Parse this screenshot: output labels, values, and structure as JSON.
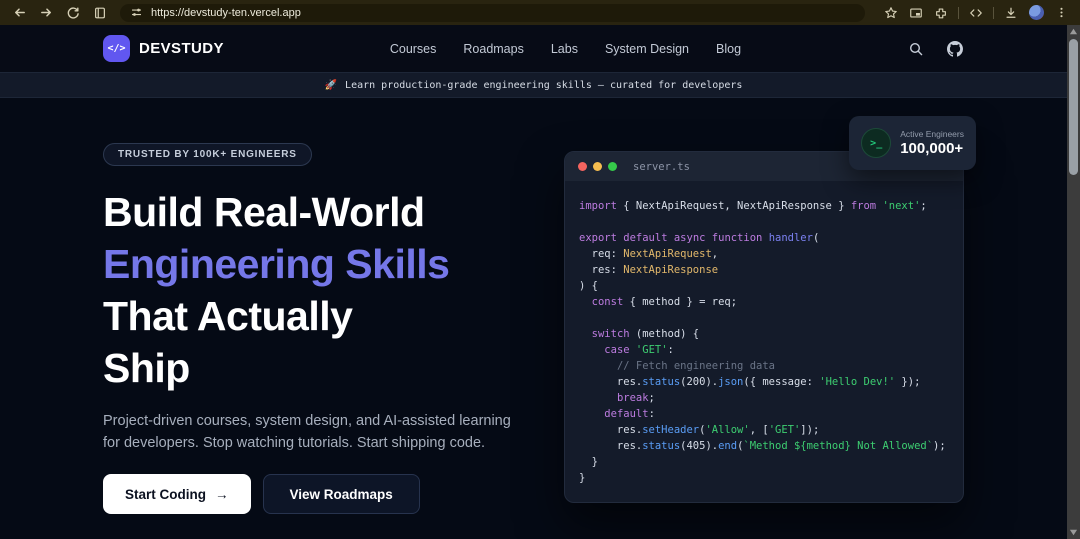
{
  "browser": {
    "url": "https://devstudy-ten.vercel.app",
    "icons_left": [
      "back",
      "forward",
      "reload",
      "reading-list",
      "tune"
    ],
    "icons_right": [
      "bookmark-star",
      "picture-in-picture",
      "extensions",
      "devtools-code",
      "download",
      "profile-avatar",
      "menu"
    ]
  },
  "scrollbar": {
    "position": "top"
  },
  "nav": {
    "logo_glyph": "</>",
    "brand": "DEVSTUDY",
    "links": [
      "Courses",
      "Roadmaps",
      "Labs",
      "System Design",
      "Blog"
    ],
    "icons": [
      "search",
      "github"
    ]
  },
  "banner": {
    "emoji": "🚀",
    "text": "Learn production-grade engineering skills — curated for developers"
  },
  "hero": {
    "badge": "TRUSTED BY 100K+ ENGINEERS",
    "heading_lines": [
      {
        "text": "Build Real-World",
        "accent": false
      },
      {
        "text": "Engineering Skills",
        "accent": true
      },
      {
        "text": "That Actually",
        "accent": false
      },
      {
        "text": "Ship",
        "accent": false
      }
    ],
    "description": "Project-driven courses, system design, and AI-assisted learning for developers. Stop watching tutorials. Start shipping code.",
    "primary_cta": "Start Coding",
    "primary_cta_arrow": "→",
    "secondary_cta": "View Roadmaps"
  },
  "stat_card": {
    "icon_glyph": ">_",
    "label": "Active Engineers",
    "value": "100,000+"
  },
  "editor": {
    "filename": "server.ts",
    "code_lines": [
      [
        {
          "t": "import",
          "c": "kw"
        },
        {
          "t": " { NextApiRequest, NextApiResponse } ",
          "c": "pl"
        },
        {
          "t": "from",
          "c": "kw"
        },
        {
          "t": " ",
          "c": "pl"
        },
        {
          "t": "'next'",
          "c": "str"
        },
        {
          "t": ";",
          "c": "pl"
        }
      ],
      [],
      [
        {
          "t": "export",
          "c": "kw"
        },
        {
          "t": " ",
          "c": "pl"
        },
        {
          "t": "default",
          "c": "kw"
        },
        {
          "t": " ",
          "c": "pl"
        },
        {
          "t": "async",
          "c": "kw"
        },
        {
          "t": " ",
          "c": "pl"
        },
        {
          "t": "function",
          "c": "kw"
        },
        {
          "t": " ",
          "c": "pl"
        },
        {
          "t": "handler",
          "c": "fn"
        },
        {
          "t": "(",
          "c": "pl"
        }
      ],
      [
        {
          "t": "  req: ",
          "c": "pl"
        },
        {
          "t": "NextApiRequest",
          "c": "type"
        },
        {
          "t": ",",
          "c": "pl"
        }
      ],
      [
        {
          "t": "  res: ",
          "c": "pl"
        },
        {
          "t": "NextApiResponse",
          "c": "type"
        }
      ],
      [
        {
          "t": ") {",
          "c": "pl"
        }
      ],
      [
        {
          "t": "  ",
          "c": "pl"
        },
        {
          "t": "const",
          "c": "kw"
        },
        {
          "t": " { method } = req;",
          "c": "pl"
        }
      ],
      [],
      [
        {
          "t": "  ",
          "c": "pl"
        },
        {
          "t": "switch",
          "c": "kw"
        },
        {
          "t": " (method) {",
          "c": "pl"
        }
      ],
      [
        {
          "t": "    ",
          "c": "pl"
        },
        {
          "t": "case",
          "c": "kw"
        },
        {
          "t": " ",
          "c": "pl"
        },
        {
          "t": "'GET'",
          "c": "str"
        },
        {
          "t": ":",
          "c": "pl"
        }
      ],
      [
        {
          "t": "      ",
          "c": "pl"
        },
        {
          "t": "// Fetch engineering data",
          "c": "cm"
        }
      ],
      [
        {
          "t": "      res.",
          "c": "pl"
        },
        {
          "t": "status",
          "c": "mth"
        },
        {
          "t": "(200).",
          "c": "pl"
        },
        {
          "t": "json",
          "c": "mth"
        },
        {
          "t": "({ message: ",
          "c": "pl"
        },
        {
          "t": "'Hello Dev!'",
          "c": "str"
        },
        {
          "t": " });",
          "c": "pl"
        }
      ],
      [
        {
          "t": "      ",
          "c": "pl"
        },
        {
          "t": "break",
          "c": "kw"
        },
        {
          "t": ";",
          "c": "pl"
        }
      ],
      [
        {
          "t": "    ",
          "c": "pl"
        },
        {
          "t": "default",
          "c": "kw"
        },
        {
          "t": ":",
          "c": "pl"
        }
      ],
      [
        {
          "t": "      res.",
          "c": "pl"
        },
        {
          "t": "setHeader",
          "c": "mth"
        },
        {
          "t": "(",
          "c": "pl"
        },
        {
          "t": "'Allow'",
          "c": "str"
        },
        {
          "t": ", [",
          "c": "pl"
        },
        {
          "t": "'GET'",
          "c": "str"
        },
        {
          "t": "]);",
          "c": "pl"
        }
      ],
      [
        {
          "t": "      res.",
          "c": "pl"
        },
        {
          "t": "status",
          "c": "mth"
        },
        {
          "t": "(405).",
          "c": "pl"
        },
        {
          "t": "end",
          "c": "mth"
        },
        {
          "t": "(",
          "c": "pl"
        },
        {
          "t": "`Method ${method} Not Allowed`",
          "c": "str"
        },
        {
          "t": ");",
          "c": "pl"
        }
      ],
      [
        {
          "t": "  }",
          "c": "pl"
        }
      ],
      [
        {
          "t": "}",
          "c": "pl"
        }
      ]
    ]
  },
  "colors": {
    "accent": "#7577e8",
    "logo-bg": "#6157f0",
    "page-bg": "#050a15",
    "nav-bg": "#070b16",
    "banner-bg": "#131a29",
    "card-bg": "#141b2a",
    "card-titlebar": "#1d2534",
    "stat-bg": "#1c2536",
    "chrome-bg": "#292410",
    "chrome-pill": "#1e1a09",
    "dot-red": "#f4645f",
    "dot-yellow": "#f5bd4f",
    "dot-green": "#35c94a",
    "terminal-green": "#22c77a",
    "tok-kw": "#bd7ce0",
    "tok-fn": "#7b80f0",
    "tok-mth": "#5a9df5",
    "tok-type": "#e2b86b",
    "tok-str": "#3dce71",
    "tok-cm": "#6a7487",
    "tok-pl": "#d8dee9"
  }
}
